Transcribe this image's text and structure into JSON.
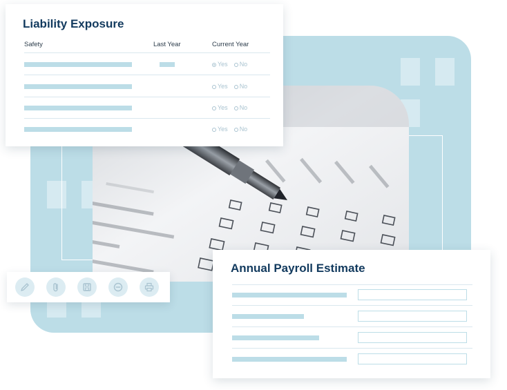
{
  "liability": {
    "title": "Liability Exposure",
    "columns": {
      "safety": "Safety",
      "last_year": "Last Year",
      "current_year": "Current Year"
    },
    "rows": [
      {
        "selected": "yes",
        "yes_label": "Yes",
        "no_label": "No"
      },
      {
        "selected": "none",
        "yes_label": "Yes",
        "no_label": "No"
      },
      {
        "selected": "none",
        "yes_label": "Yes",
        "no_label": "No"
      },
      {
        "selected": "none",
        "yes_label": "Yes",
        "no_label": "No"
      }
    ]
  },
  "payroll": {
    "title": "Annual Payroll Estimate"
  },
  "toolbar": {
    "icons": [
      "pencil-icon",
      "paperclip-icon",
      "save-icon",
      "minus-circle-icon",
      "printer-icon"
    ]
  },
  "colors": {
    "accent": "#bcdde7",
    "title": "#123a5e",
    "radio": "#a9c3d0"
  }
}
